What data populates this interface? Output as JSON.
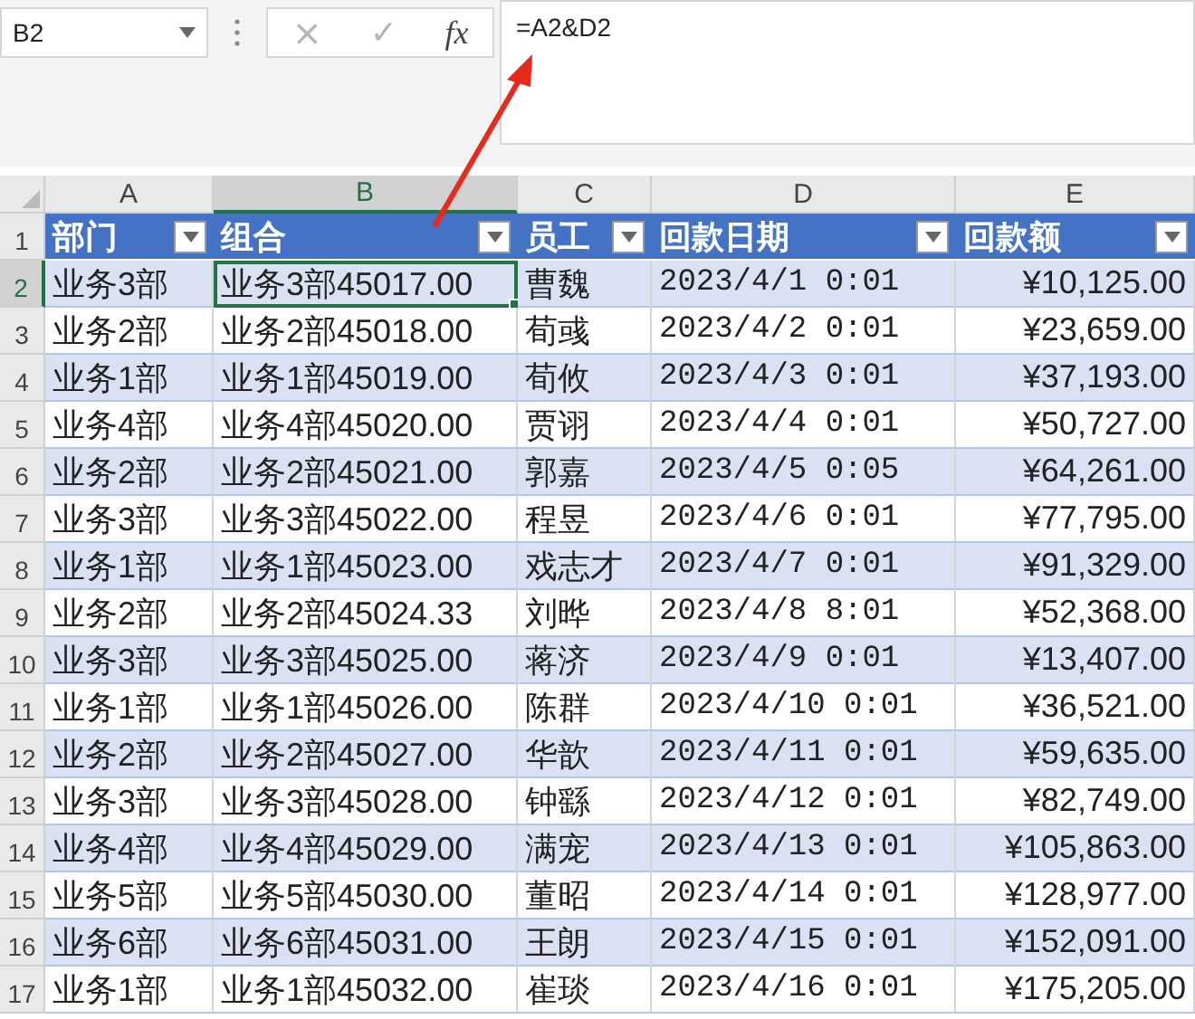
{
  "name_box": {
    "value": "B2"
  },
  "formula_bar": {
    "cancel": "×",
    "enter": "✓",
    "function": "fx",
    "value": "=A2&D2"
  },
  "columns": [
    {
      "label": "A",
      "selected": false
    },
    {
      "label": "B",
      "selected": true
    },
    {
      "label": "C",
      "selected": false
    },
    {
      "label": "D",
      "selected": false
    },
    {
      "label": "E",
      "selected": false
    }
  ],
  "header_row": {
    "number": "1",
    "selected": false,
    "cells": [
      "部门",
      "组合",
      "员工",
      "回款日期",
      "回款额"
    ]
  },
  "rows": [
    {
      "number": "2",
      "selected": true,
      "cells": [
        "业务3部",
        "业务3部45017.00",
        "曹魏",
        "2023/4/1 0:01",
        "¥10,125.00"
      ]
    },
    {
      "number": "3",
      "selected": false,
      "cells": [
        "业务2部",
        "业务2部45018.00",
        "荀彧",
        "2023/4/2 0:01",
        "¥23,659.00"
      ]
    },
    {
      "number": "4",
      "selected": false,
      "cells": [
        "业务1部",
        "业务1部45019.00",
        "荀攸",
        "2023/4/3 0:01",
        "¥37,193.00"
      ]
    },
    {
      "number": "5",
      "selected": false,
      "cells": [
        "业务4部",
        "业务4部45020.00",
        "贾诩",
        "2023/4/4 0:01",
        "¥50,727.00"
      ]
    },
    {
      "number": "6",
      "selected": false,
      "cells": [
        "业务2部",
        "业务2部45021.00",
        "郭嘉",
        "2023/4/5 0:05",
        "¥64,261.00"
      ]
    },
    {
      "number": "7",
      "selected": false,
      "cells": [
        "业务3部",
        "业务3部45022.00",
        "程昱",
        "2023/4/6 0:01",
        "¥77,795.00"
      ]
    },
    {
      "number": "8",
      "selected": false,
      "cells": [
        "业务1部",
        "业务1部45023.00",
        "戏志才",
        "2023/4/7 0:01",
        "¥91,329.00"
      ]
    },
    {
      "number": "9",
      "selected": false,
      "cells": [
        "业务2部",
        "业务2部45024.33",
        "刘晔",
        "2023/4/8 8:01",
        "¥52,368.00"
      ]
    },
    {
      "number": "10",
      "selected": false,
      "cells": [
        "业务3部",
        "业务3部45025.00",
        "蒋济",
        "2023/4/9 0:01",
        "¥13,407.00"
      ]
    },
    {
      "number": "11",
      "selected": false,
      "cells": [
        "业务1部",
        "业务1部45026.00",
        "陈群",
        "2023/4/10 0:01",
        "¥36,521.00"
      ]
    },
    {
      "number": "12",
      "selected": false,
      "cells": [
        "业务2部",
        "业务2部45027.00",
        "华歆",
        "2023/4/11 0:01",
        "¥59,635.00"
      ]
    },
    {
      "number": "13",
      "selected": false,
      "cells": [
        "业务3部",
        "业务3部45028.00",
        "钟繇",
        "2023/4/12 0:01",
        "¥82,749.00"
      ]
    },
    {
      "number": "14",
      "selected": false,
      "cells": [
        "业务4部",
        "业务4部45029.00",
        "满宠",
        "2023/4/13 0:01",
        "¥105,863.00"
      ]
    },
    {
      "number": "15",
      "selected": false,
      "cells": [
        "业务5部",
        "业务5部45030.00",
        "董昭",
        "2023/4/14 0:01",
        "¥128,977.00"
      ]
    },
    {
      "number": "16",
      "selected": false,
      "cells": [
        "业务6部",
        "业务6部45031.00",
        "王朗",
        "2023/4/15 0:01",
        "¥152,091.00"
      ]
    },
    {
      "number": "17",
      "selected": false,
      "cells": [
        "业务1部",
        "业务1部45032.00",
        "崔琰",
        "2023/4/16 0:01",
        "¥175,205.00"
      ]
    }
  ]
}
